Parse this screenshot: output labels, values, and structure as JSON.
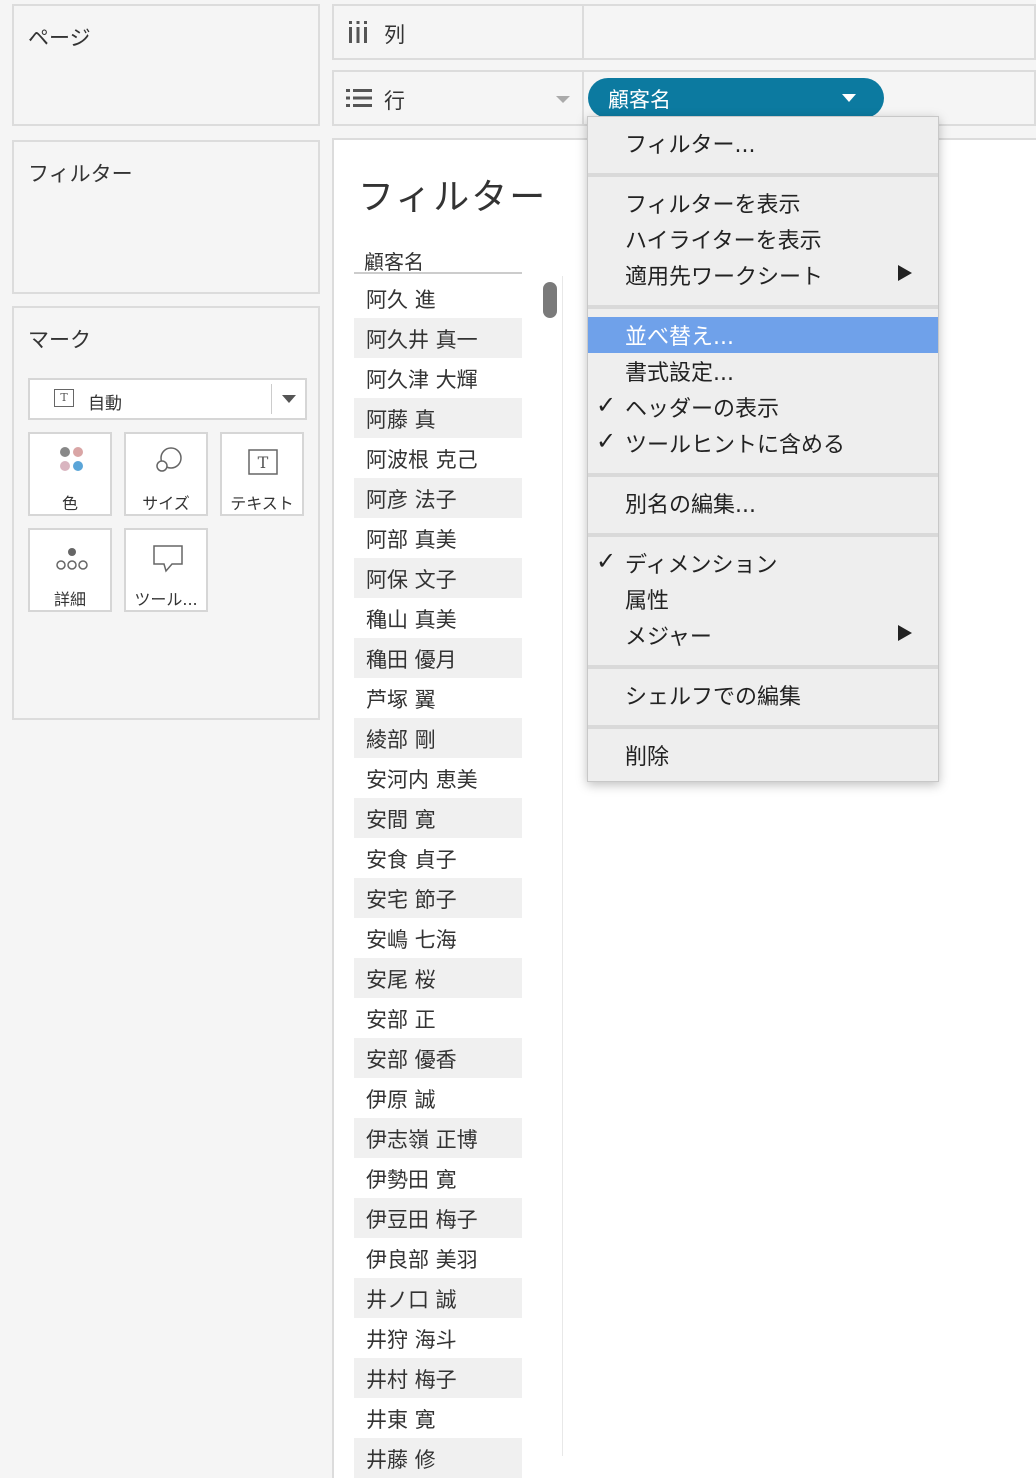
{
  "pages": {
    "title": "ページ"
  },
  "filters": {
    "title": "フィルター"
  },
  "marks": {
    "title": "マーク",
    "type_label": "自動",
    "buttons": [
      {
        "label": "色",
        "icon": "color-icon"
      },
      {
        "label": "サイズ",
        "icon": "size-icon"
      },
      {
        "label": "テキスト",
        "icon": "text-icon"
      },
      {
        "label": "詳細",
        "icon": "detail-icon"
      },
      {
        "label": "ツール...",
        "icon": "tooltip-icon"
      }
    ]
  },
  "shelves": {
    "columns_label": "列",
    "rows_label": "行",
    "row_pill": "顧客名"
  },
  "view": {
    "title": "フィルター",
    "column_header": "顧客名",
    "rows": [
      "阿久 進",
      "阿久井 真一",
      "阿久津 大輝",
      "阿藤 真",
      "阿波根 克己",
      "阿彦 法子",
      "阿部 真美",
      "阿保 文子",
      "穐山 真美",
      "穐田 優月",
      "芦塚 翼",
      "綾部 剛",
      "安河内 恵美",
      "安間 寛",
      "安食 貞子",
      "安宅 節子",
      "安嶋 七海",
      "安尾 桜",
      "安部 正",
      "安部 優香",
      "伊原 誠",
      "伊志嶺 正博",
      "伊勢田 寛",
      "伊豆田 梅子",
      "伊良部 美羽",
      "井ノ口 誠",
      "井狩 海斗",
      "井村 梅子",
      "井東 寛",
      "井藤 修"
    ]
  },
  "context_menu": {
    "filter": "フィルター...",
    "show_filter": "フィルターを表示",
    "show_highlighter": "ハイライターを表示",
    "apply_to_worksheets": "適用先ワークシート",
    "sort": "並べ替え...",
    "format": "書式設定...",
    "show_header": "ヘッダーの表示",
    "include_in_tooltip": "ツールヒントに含める",
    "edit_aliases": "別名の編集...",
    "dimension": "ディメンション",
    "attribute": "属性",
    "measure": "メジャー",
    "edit_in_shelf": "シェルフでの編集",
    "remove": "削除",
    "check": "✓"
  },
  "colors": {
    "pill": "#0c7aa0",
    "highlight": "#6fa1ea"
  }
}
